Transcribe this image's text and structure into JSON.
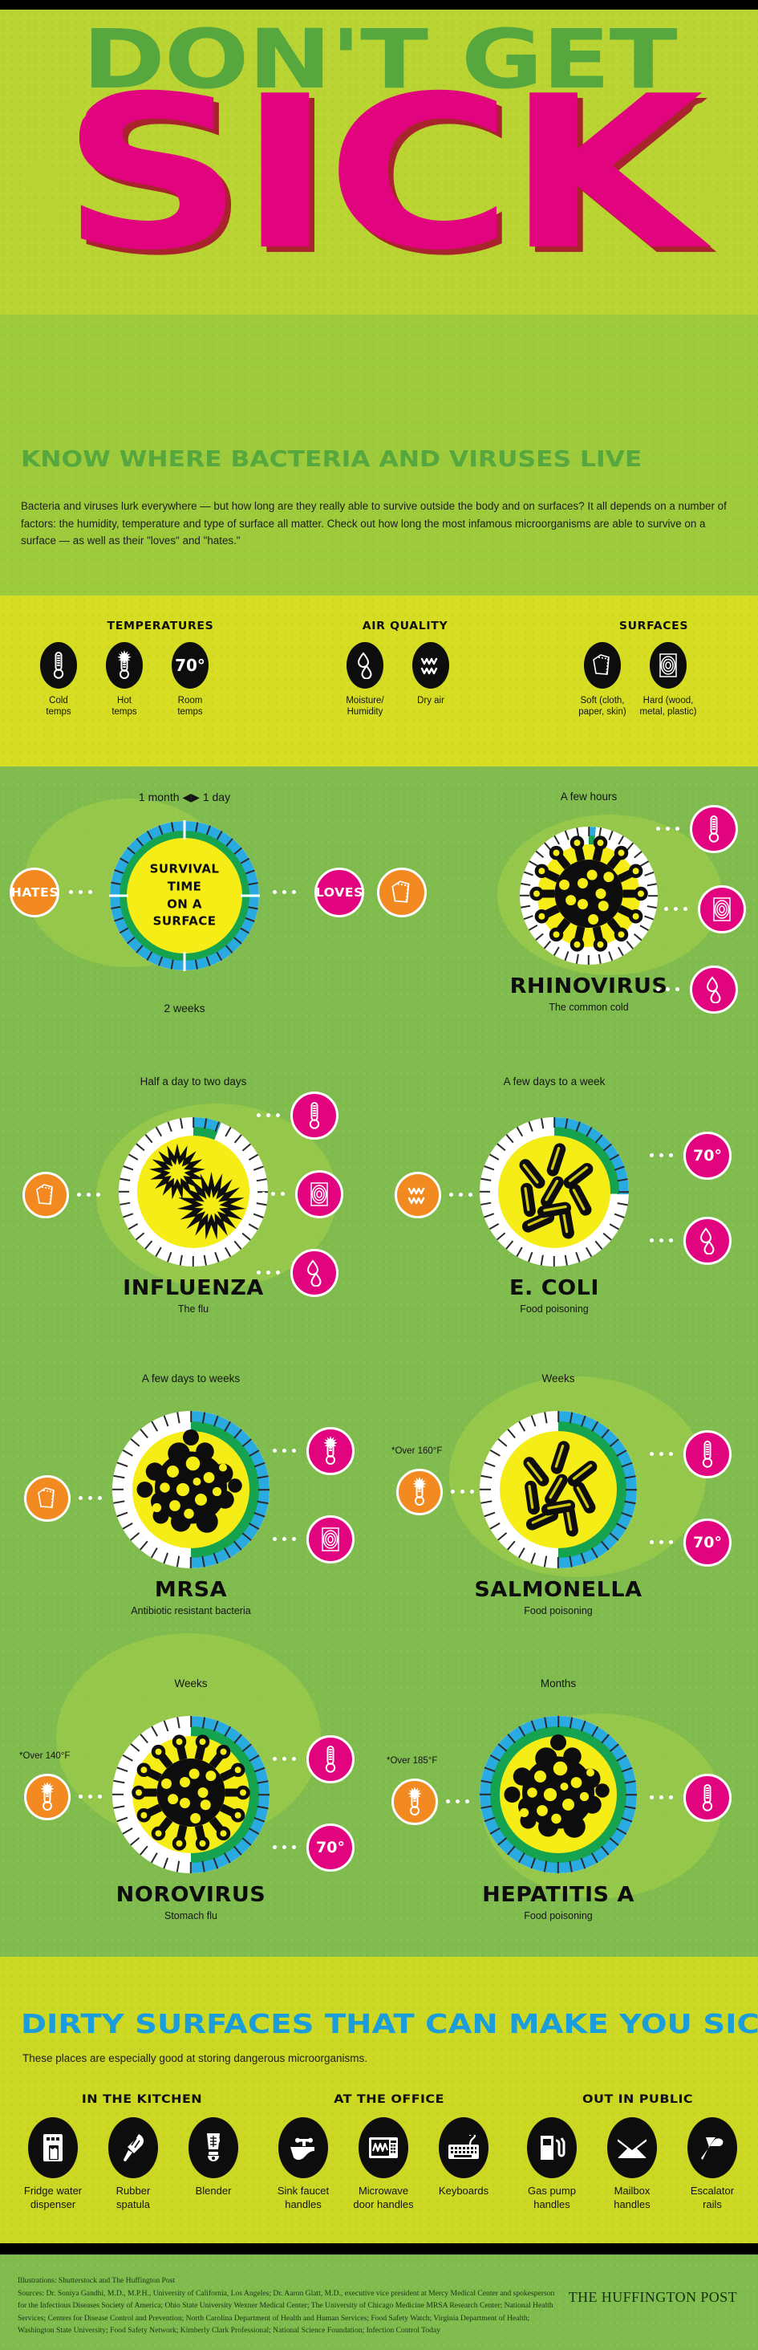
{
  "header": {
    "title_line1": "DON'T GET",
    "title_line2": "SICK",
    "subtitle": "KNOW WHERE BACTERIA AND VIRUSES LIVE",
    "intro": "Bacteria and viruses lurk everywhere — but how long are they really able to survive outside the body and on surfaces? It all depends on a number of factors: the humidity, temperature and type of surface all matter. Check out how long the most infamous microorganisms are able to survive on a surface — as well as their \"loves\" and \"hates.\"",
    "colors": {
      "title_green": "#56a73d",
      "sick_pink": "#e2047e",
      "hero_bg": "#b9d433"
    }
  },
  "legend": {
    "groups": [
      {
        "heading": "TEMPERATURES",
        "items": [
          {
            "icon": "cold-thermometer-icon",
            "label": "Cold\ntemps"
          },
          {
            "icon": "hot-thermometer-icon",
            "label": "Hot\ntemps"
          },
          {
            "icon": "room-temp-70-icon",
            "label": "Room\ntemps",
            "value": "70°"
          }
        ]
      },
      {
        "heading": "AIR QUALITY",
        "items": [
          {
            "icon": "water-droplets-icon",
            "label": "Moisture/\nHumidity"
          },
          {
            "icon": "dry-air-waves-icon",
            "label": "Dry air"
          }
        ]
      },
      {
        "heading": "SURFACES",
        "items": [
          {
            "icon": "soft-surface-paper-icon",
            "label": "Soft (cloth,\npaper, skin)"
          },
          {
            "icon": "hard-surface-woodgrain-icon",
            "label": "Hard (wood,\nmetal, plastic)"
          }
        ]
      }
    ]
  },
  "key": {
    "top_label": "1 month ◀▶ 1 day",
    "bottom_label": "2 weeks",
    "center_text": "SURVIVAL\nTIME\nON A\nSURFACE",
    "hates_label": "HATES",
    "loves_label": "LOVES",
    "loves_icon": "soft-surface-paper-icon"
  },
  "germs": [
    {
      "name": "RHINOVIRUS",
      "subtitle": "The common cold",
      "time": "A few hours",
      "arc_degrees": 6,
      "germ_icon": "spiky-virus-icon",
      "hates": [],
      "hates_note": "",
      "loves": [
        {
          "icon": "cold-thermometer-icon"
        },
        {
          "icon": "hard-surface-woodgrain-icon"
        },
        {
          "icon": "water-droplets-icon"
        }
      ]
    },
    {
      "name": "INFLUENZA",
      "subtitle": "The flu",
      "time": "Half a day to two days",
      "arc_degrees": 22,
      "germ_icon": "starburst-virus-icon",
      "hates": [
        {
          "icon": "soft-surface-paper-icon"
        }
      ],
      "hates_note": "",
      "loves": [
        {
          "icon": "cold-thermometer-icon"
        },
        {
          "icon": "hard-surface-woodgrain-icon"
        },
        {
          "icon": "water-droplets-icon"
        }
      ]
    },
    {
      "name": "E. COLI",
      "subtitle": "Food poisoning",
      "time": "A few days to a week",
      "arc_degrees": 92,
      "germ_icon": "rod-bacteria-icon",
      "hates": [
        {
          "icon": "dry-air-waves-icon"
        }
      ],
      "hates_note": "",
      "loves": [
        {
          "icon": "room-temp-70-icon",
          "value": "70°"
        },
        {
          "icon": "water-droplets-icon"
        }
      ]
    },
    {
      "name": "MRSA",
      "subtitle": "Antibiotic resistant bacteria",
      "time": "A few days to weeks",
      "arc_degrees": 180,
      "germ_icon": "cluster-bacteria-icon",
      "hates": [
        {
          "icon": "soft-surface-paper-icon"
        }
      ],
      "hates_note": "",
      "loves": [
        {
          "icon": "hot-thermometer-icon"
        },
        {
          "icon": "hard-surface-woodgrain-icon"
        }
      ]
    },
    {
      "name": "SALMONELLA",
      "subtitle": "Food poisoning",
      "time": "Weeks",
      "arc_degrees": 180,
      "germ_icon": "rod-bacteria-icon",
      "hates": [
        {
          "icon": "hot-thermometer-icon"
        }
      ],
      "hates_note": "*Over 160°F",
      "loves": [
        {
          "icon": "cold-thermometer-icon"
        },
        {
          "icon": "room-temp-70-icon",
          "value": "70°"
        }
      ]
    },
    {
      "name": "NOROVIRUS",
      "subtitle": "Stomach flu",
      "time": "Weeks",
      "arc_degrees": 180,
      "germ_icon": "spiky-virus-icon",
      "hates": [
        {
          "icon": "hot-thermometer-icon"
        }
      ],
      "hates_note": "*Over 140°F",
      "loves": [
        {
          "icon": "cold-thermometer-icon"
        },
        {
          "icon": "room-temp-70-icon",
          "value": "70°"
        }
      ]
    },
    {
      "name": "HEPATITIS A",
      "subtitle": "Food poisoning",
      "time": "Months",
      "arc_degrees": 360,
      "germ_icon": "cluster-bacteria-icon",
      "hates": [
        {
          "icon": "hot-thermometer-icon"
        }
      ],
      "hates_note": "*Over 185°F",
      "loves": [
        {
          "icon": "cold-thermometer-icon"
        }
      ]
    }
  ],
  "dirty": {
    "title": "DIRTY SURFACES THAT CAN MAKE YOU SICK",
    "subtitle": "These places are especially good at storing dangerous microorganisms.",
    "groups": [
      {
        "heading": "IN THE KITCHEN",
        "items": [
          {
            "icon": "fridge-water-dispenser-icon",
            "label": "Fridge water\ndispenser"
          },
          {
            "icon": "rubber-spatula-icon",
            "label": "Rubber\nspatula"
          },
          {
            "icon": "blender-icon",
            "label": "Blender"
          }
        ]
      },
      {
        "heading": "AT THE OFFICE",
        "items": [
          {
            "icon": "sink-faucet-icon",
            "label": "Sink faucet\nhandles"
          },
          {
            "icon": "microwave-icon",
            "label": "Microwave\ndoor handles"
          },
          {
            "icon": "keyboard-icon",
            "label": "Keyboards"
          }
        ]
      },
      {
        "heading": "OUT IN PUBLIC",
        "items": [
          {
            "icon": "gas-pump-icon",
            "label": "Gas pump\nhandles"
          },
          {
            "icon": "mailbox-envelope-icon",
            "label": "Mailbox\nhandles"
          },
          {
            "icon": "escalator-rail-icon",
            "label": "Escalator\nrails"
          }
        ]
      }
    ]
  },
  "footer": {
    "illustrations": "Illustrations: Shutterstock and The Huffington Post",
    "sources": "Sources: Dr. Soniya Gandhi, M.D., M.P.H., University of California, Los Angeles; Dr. Aaron Glatt, M.D., executive vice president at Mercy Medical Center and spokesperson for the Infectious Diseases Society of America; Ohio State University Wexner Medical Center; The University of Chicago Medicine MRSA Research Center; National Health Services; Centers for Disease Control and Prevention; North Carolina Department of Health and Human Services; Food Safety Watch; Virginia Department of Health; Washington State University; Food Safety Network; Kimberly Clark Professional; National Science Foundation; Infection Control Today",
    "brand": "THE HUFFINGTON POST"
  },
  "colors": {
    "pink": "#e2047e",
    "orange": "#f28a21",
    "yellow": "#f6ec16",
    "blue": "#29abe2",
    "green_ring": "#16a350",
    "cyan_title": "#1b9ddb"
  }
}
